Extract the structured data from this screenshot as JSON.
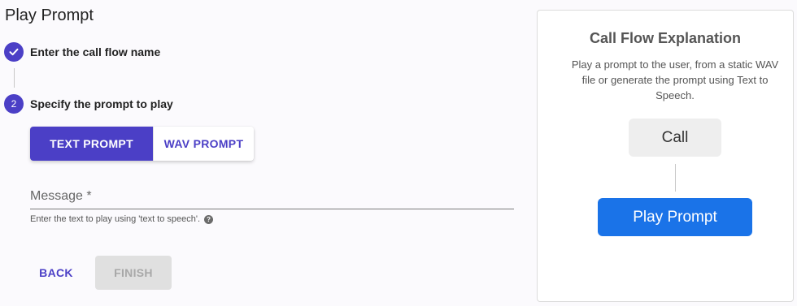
{
  "page": {
    "title": "Play Prompt"
  },
  "steps": [
    {
      "indicator": "",
      "label": "Enter the call flow name",
      "state": "completed"
    },
    {
      "indicator": "2",
      "label": "Specify the prompt to play",
      "state": "active"
    }
  ],
  "prompt_type": {
    "options": [
      "TEXT PROMPT",
      "WAV PROMPT"
    ],
    "selected": "TEXT PROMPT"
  },
  "message": {
    "label": "Message *",
    "value": "",
    "helper": "Enter the text to play using 'text to speech'."
  },
  "actions": {
    "back_label": "BACK",
    "finish_label": "FINISH"
  },
  "explanation": {
    "title": "Call Flow Explanation",
    "description": "Play a prompt to the user, from a static WAV file or generate the prompt using Text to Speech.",
    "nodes": [
      "Call",
      "Play Prompt"
    ]
  },
  "colors": {
    "accent": "#4b3fc6",
    "node_primary": "#1a73e8",
    "node_secondary": "#eeeeee"
  },
  "icons": {
    "step_complete": "check-icon",
    "help": "help-icon"
  }
}
